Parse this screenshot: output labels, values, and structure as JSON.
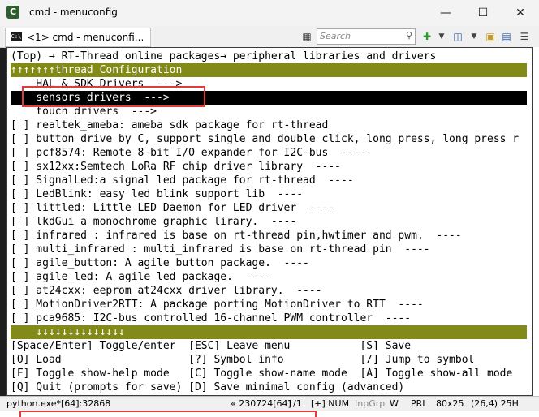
{
  "window": {
    "title": "cmd - menuconfig",
    "icon": "app-icon",
    "controls": [
      "minimize-icon",
      "maximize-icon",
      "close-icon"
    ]
  },
  "tab": {
    "label": "<1> cmd - menuconfi...",
    "icon": "console-icon"
  },
  "search": {
    "placeholder": "Search"
  },
  "breadcrumb": "(Top) → RT-Thread online packages→ peripheral libraries and drivers",
  "header": "↑↑↑↑↑↑↑thread Configuration",
  "items": [
    {
      "text": "    HAL & SDK Drivers  --->"
    },
    {
      "text": "    sensors drivers  --->",
      "selected": true
    },
    {
      "text": "    touch drivers  --->"
    },
    {
      "text": "[ ] realtek_ameba: ameba sdk package for rt-thread"
    },
    {
      "text": "[ ] button drive by C, support single and double click, long press, long press r"
    },
    {
      "text": "[ ] pcf8574: Remote 8-bit I/O expander for I2C-bus  ----"
    },
    {
      "text": "[ ] sx12xx:Semtech LoRa RF chip driver library  ----"
    },
    {
      "text": "[ ] SignalLed:a signal led package for rt-thread  ----"
    },
    {
      "text": "[ ] LedBlink: easy led blink support lib  ----"
    },
    {
      "text": "[ ] littled: Little LED Daemon for LED driver  ----"
    },
    {
      "text": "[ ] lkdGui a monochrome graphic lirary.  ----"
    },
    {
      "text": "[ ] infrared : infrared is base on rt-thread pin,hwtimer and pwm.  ----"
    },
    {
      "text": "[ ] multi_infrared : multi_infrared is base on rt-thread pin  ----"
    },
    {
      "text": "[ ] agile_button: A agile button package.  ----"
    },
    {
      "text": "[ ] agile_led: A agile led package.  ----"
    },
    {
      "text": "[ ] at24cxx: eeprom at24cxx driver library.  ----"
    },
    {
      "text": "[ ] MotionDriver2RTT: A package porting MotionDriver to RTT  ----"
    },
    {
      "text": "[ ] pca9685: I2C-bus controlled 16-channel PWM controller  ----"
    }
  ],
  "footer_arrows": "    ↓↓↓↓↓↓↓↓↓↓↓↓↓↓",
  "help": [
    "[Space/Enter] Toggle/enter  [ESC] Leave menu           [S] Save",
    "[O] Load                    [?] Symbol info            [/] Jump to symbol",
    "[F] Toggle show-help mode   [C] Toggle show-name mode  [A] Toggle show-all mode",
    "[Q] Quit (prompts for save) [D] Save minimal config (advanced)"
  ],
  "status": {
    "process": "python.exe*[64]:32868",
    "position": "« 230724[64]",
    "pages": "1/1",
    "mode": "[+] NUM",
    "inpgrp": "InpGrp",
    "w": "W",
    "pri": "PRI",
    "size": "80x25",
    "cursor": "(26,4) 25H"
  }
}
